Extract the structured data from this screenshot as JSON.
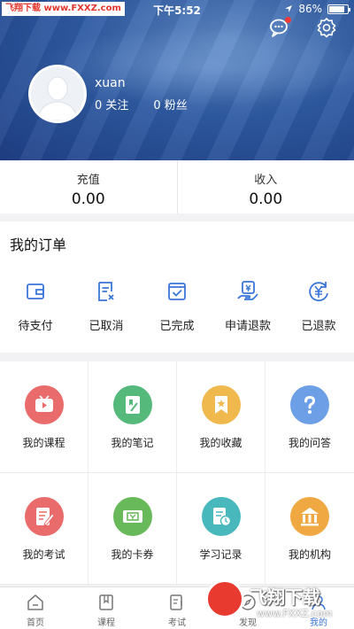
{
  "status_bar": {
    "watermark": "飞翔下载 www.FXXZ.com",
    "time": "下午5:52",
    "battery": "86%",
    "battery_level": 0.86
  },
  "profile": {
    "username": "xuan",
    "following": "0 关注",
    "followers": "0 粉丝"
  },
  "balance": [
    {
      "label": "充值",
      "value": "0.00"
    },
    {
      "label": "收入",
      "value": "0.00"
    }
  ],
  "orders": {
    "title": "我的订单",
    "items": [
      {
        "label": "待支付",
        "icon": "wallet-icon"
      },
      {
        "label": "已取消",
        "icon": "cancelled-doc-icon"
      },
      {
        "label": "已完成",
        "icon": "check-box-icon"
      },
      {
        "label": "申请退款",
        "icon": "refund-request-icon"
      },
      {
        "label": "已退款",
        "icon": "refunded-yuan-icon"
      }
    ]
  },
  "features": [
    {
      "label": "我的课程",
      "icon": "video-course-icon",
      "color": "#ea6b6b"
    },
    {
      "label": "我的笔记",
      "icon": "notes-icon",
      "color": "#55b97b"
    },
    {
      "label": "我的收藏",
      "icon": "favorites-icon",
      "color": "#f0b94e"
    },
    {
      "label": "我的问答",
      "icon": "question-icon",
      "color": "#6c9fe6"
    },
    {
      "label": "我的考试",
      "icon": "exam-icon",
      "color": "#ea6b6b"
    },
    {
      "label": "我的卡券",
      "icon": "coupon-icon",
      "color": "#68b95a"
    },
    {
      "label": "学习记录",
      "icon": "study-record-icon",
      "color": "#49b8bd"
    },
    {
      "label": "我的机构",
      "icon": "institution-icon",
      "color": "#f0a942"
    }
  ],
  "tabs": [
    {
      "label": "首页",
      "icon": "home-icon"
    },
    {
      "label": "课程",
      "icon": "course-icon"
    },
    {
      "label": "考试",
      "icon": "exam-tab-icon"
    },
    {
      "label": "发现",
      "icon": "discover-icon"
    },
    {
      "label": "我的",
      "icon": "profile-icon",
      "active": true
    }
  ],
  "watermark_bottom": {
    "title": "飞翔下载",
    "url": "www.FXXZ.com"
  },
  "colors": {
    "accent": "#3a76d8",
    "header": "#2f5ba3",
    "notification_dot": "#f03b3b"
  }
}
